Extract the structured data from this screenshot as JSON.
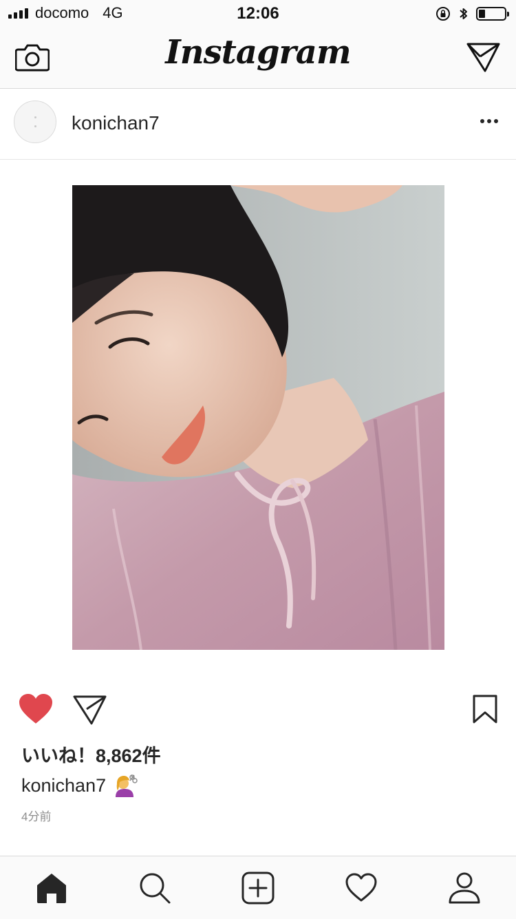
{
  "status_bar": {
    "carrier": "docomo",
    "network": "4G",
    "time": "12:06",
    "battery_level": 0.25
  },
  "app": {
    "logo_text": "Instagram"
  },
  "post": {
    "username": "konichan7",
    "likes_text": "いいね！8,862件",
    "caption_user": "konichan7",
    "caption_emoji": "woman-getting-haircut-emoji",
    "time_ago": "4分前",
    "liked": true
  },
  "icons": {
    "camera": "camera-icon",
    "direct": "paper-plane-icon",
    "more": "more-options-icon",
    "like": "heart-filled-icon",
    "share": "paper-plane-icon",
    "save": "bookmark-icon",
    "home": "home-icon",
    "search": "search-icon",
    "new_post": "plus-square-icon",
    "activity": "heart-outline-icon",
    "profile": "person-icon"
  },
  "colors": {
    "like_red": "#e0474e",
    "text_dark": "#262626",
    "meta_gray": "#8e8e8e"
  }
}
